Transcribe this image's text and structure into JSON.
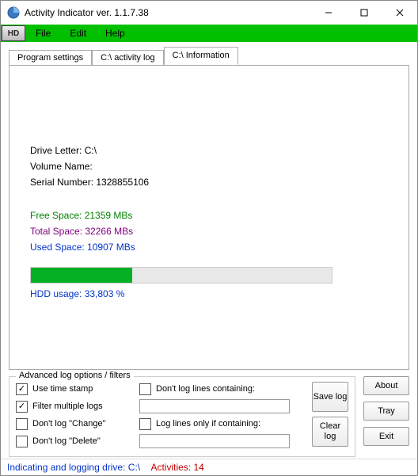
{
  "window": {
    "title": "Activity Indicator ver. 1.1.7.38"
  },
  "menu": {
    "file": "File",
    "edit": "Edit",
    "help": "Help",
    "hd_badge": "HD"
  },
  "tabs": {
    "program_settings": "Program settings",
    "activity_log": "C:\\ activity log",
    "information": "C:\\ Information"
  },
  "info": {
    "drive_letter_label": "Drive Letter: C:\\",
    "volume_name_label": "Volume Name:",
    "serial_label": "Serial Number: 1328855106",
    "free_space": "Free Space: 21359 MBs",
    "total_space": "Total Space: 32266 MBs",
    "used_space": "Used Space: 10907 MBs",
    "usage_label": "HDD usage:  33,803 %",
    "usage_percent": 33.803
  },
  "adv": {
    "legend": "Advanced log options / filters",
    "use_timestamp": "Use time stamp",
    "filter_multiple": "Filter multiple logs",
    "dont_log_change": "Don't log \"Change\"",
    "dont_log_delete": "Don't log \"Delete\"",
    "dont_log_containing": "Don't log lines containing:",
    "log_only_containing": "Log lines only if containing:",
    "filter1_value": "",
    "filter2_value": "",
    "btn_save": "Save log",
    "btn_clear": "Clear log"
  },
  "side_buttons": {
    "about": "About",
    "tray": "Tray",
    "exit": "Exit"
  },
  "status": {
    "indicating": "Indicating and logging  drive: C:\\",
    "activities": "Activities: 14"
  }
}
